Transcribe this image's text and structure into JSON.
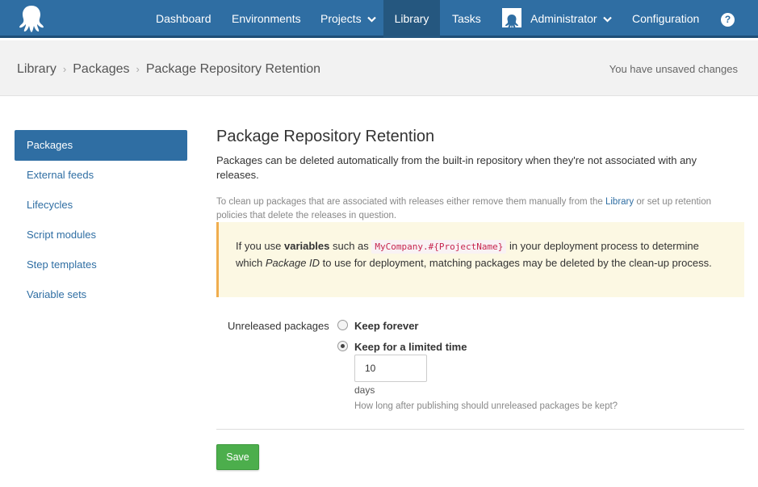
{
  "colors": {
    "nav_bg": "#2f6ea3",
    "accent": "#2f6ea3",
    "save_green": "#4cae4c",
    "warning_bg": "#fcf8e3",
    "warning_border": "#f0ad4e"
  },
  "nav": {
    "items": [
      {
        "label": "Dashboard"
      },
      {
        "label": "Environments"
      },
      {
        "label": "Projects",
        "icon": "chevron-down-icon"
      },
      {
        "label": "Library",
        "active": true
      },
      {
        "label": "Tasks"
      },
      {
        "label": "Administrator",
        "icon": "chevron-down-icon"
      },
      {
        "label": "Configuration"
      }
    ],
    "help_icon": "?"
  },
  "breadcrumb": {
    "items": [
      "Library",
      "Packages",
      "Package Repository Retention"
    ],
    "separator": "›",
    "status": "You have unsaved changes"
  },
  "sidebar": {
    "items": [
      {
        "label": "Packages",
        "active": true
      },
      {
        "label": "External feeds"
      },
      {
        "label": "Lifecycles"
      },
      {
        "label": "Script modules"
      },
      {
        "label": "Step templates"
      },
      {
        "label": "Variable sets"
      }
    ]
  },
  "main": {
    "title": "Package Repository Retention",
    "intro": "Packages can be deleted automatically from the built-in repository when they're not associated with any releases.",
    "hint_before": "To clean up packages that are associated with releases either remove them manually from the ",
    "hint_link": "Library",
    "hint_after": " or set up retention policies that delete the releases in question.",
    "warning": {
      "t1": "If you use ",
      "bold": "variables",
      "t2": " such as ",
      "code": "MyCompany.#{ProjectName}",
      "t3": " in your deployment process to determine which ",
      "italic": "Package ID",
      "t4": " to use for deployment, matching packages may be deleted by the clean-up process."
    },
    "field_label": "Unreleased packages",
    "options": [
      {
        "label": "Keep forever",
        "checked": false
      },
      {
        "label": "Keep for a limited time",
        "checked": true
      }
    ],
    "days_value": "10",
    "days_unit": "days",
    "help_text": "How long after publishing should unreleased packages be kept?",
    "save_label": "Save"
  }
}
